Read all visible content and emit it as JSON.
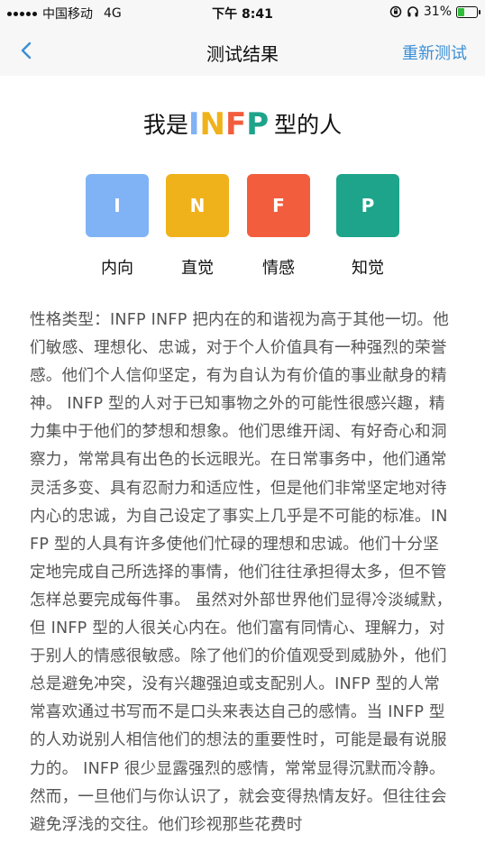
{
  "status_bar": {
    "carrier": "中国移动",
    "network": "4G",
    "time": "下午 8:41",
    "battery": "31%",
    "battery_fraction": 0.31,
    "icons": [
      "signal-dots-icon",
      "lock-rotation-icon",
      "headphones-icon",
      "battery-charging-icon"
    ]
  },
  "nav": {
    "back_icon": "chevron-left-icon",
    "title": "测试结果",
    "retest_label": "重新测试"
  },
  "result": {
    "prefix": "我是",
    "type_letters": [
      "I",
      "N",
      "F",
      "P"
    ],
    "suffix": "型的人"
  },
  "tiles": [
    {
      "letter": "I",
      "label": "内向",
      "color": "#7fb3f5"
    },
    {
      "letter": "N",
      "label": "直觉",
      "color": "#f0b21b"
    },
    {
      "letter": "F",
      "label": "情感",
      "color": "#f25d3e"
    },
    {
      "letter": "P",
      "label": "知觉",
      "color": "#1ea48a"
    }
  ],
  "description": "性格类型：INFP INFP 把内在的和谐视为高于其他一切。他们敏感、理想化、忠诚，对于个人价值具有一种强烈的荣誉感。他们个人信仰坚定，有为自认为有价值的事业献身的精神。 INFP 型的人对于已知事物之外的可能性很感兴趣，精力集中于他们的梦想和想象。他们思维开阔、有好奇心和洞察力，常常具有出色的长远眼光。在日常事务中，他们通常灵活多变、具有忍耐力和适应性，但是他们非常坚定地对待内心的忠诚，为自己设定了事实上几乎是不可能的标准。INFP 型的人具有许多使他们忙碌的理想和忠诚。他们十分坚定地完成自己所选择的事情，他们往往承担得太多，但不管怎样总要完成每件事。 虽然对外部世界他们显得冷淡缄默，但 INFP 型的人很关心内在。他们富有同情心、理解力，对于别人的情感很敏感。除了他们的价值观受到威胁外，他们总是避免冲突，没有兴趣强迫或支配别人。INFP 型的人常常喜欢通过书写而不是口头来表达自己的感情。当 INFP 型的人劝说别人相信他们的想法的重要性时，可能是最有说服力的。 INFP 很少显露强烈的感情，常常显得沉默而冷静。然而，一旦他们与你认识了，就会变得热情友好。但往往会避免浮浅的交往。他们珍视那些花费时"
}
